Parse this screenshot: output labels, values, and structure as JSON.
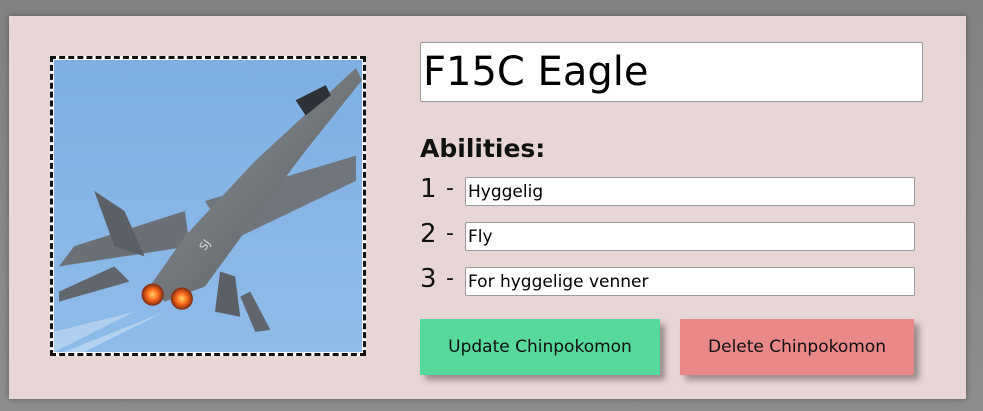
{
  "chinpokomon": {
    "name": "F15C Eagle",
    "image_alt": "F-15 fighter jet in flight"
  },
  "abilities": {
    "heading": "Abilities:",
    "items": [
      {
        "number": "1",
        "dash": "-",
        "value": "Hyggelig"
      },
      {
        "number": "2",
        "dash": "-",
        "value": "Fly"
      },
      {
        "number": "3",
        "dash": "-",
        "value": "For hyggelige venner"
      }
    ]
  },
  "actions": {
    "update_label": "Update Chinpokomon",
    "delete_label": "Delete Chinpokomon"
  },
  "colors": {
    "card_background": "#e8d6d6",
    "update_button": "#57d99b",
    "delete_button": "#ea8888"
  }
}
